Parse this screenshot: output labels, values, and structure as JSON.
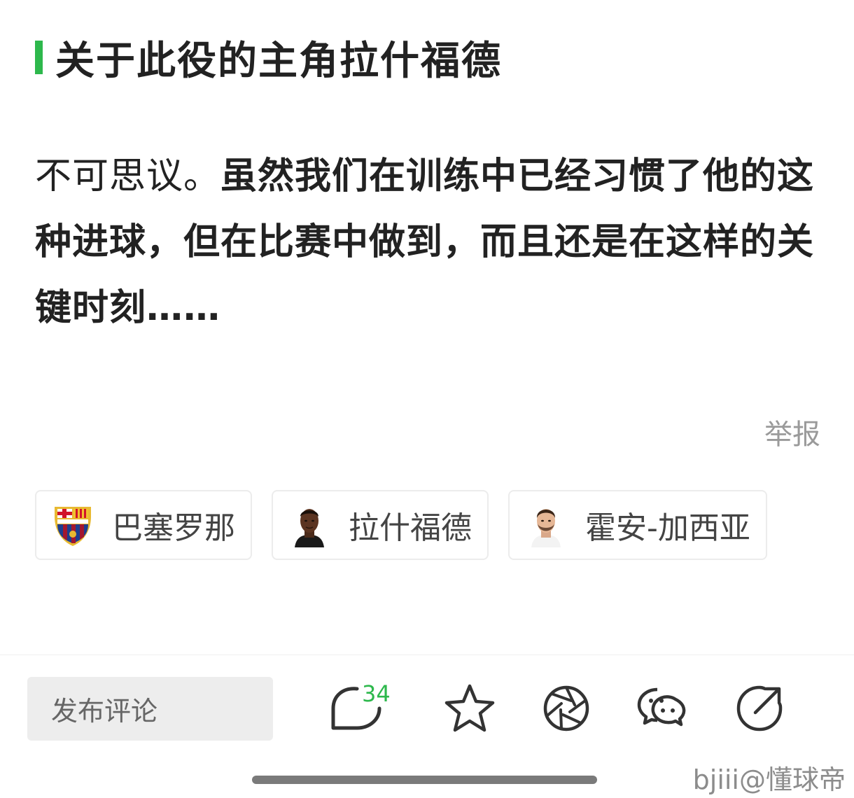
{
  "article": {
    "section_title": "关于此役的主角拉什福德",
    "body_normal": "不可思议。",
    "body_bold": "虽然我们在训练中已经习惯了他的这种进球，但在比赛中做到，而且还是在这样的关键时刻……",
    "report_label": "举报",
    "accent_color": "#2db84c"
  },
  "tags": [
    {
      "label": "巴塞罗那",
      "icon": "fc-barcelona-crest-icon"
    },
    {
      "label": "拉什福德",
      "icon": "player-avatar-icon"
    },
    {
      "label": "霍安-加西亚",
      "icon": "player-avatar-icon"
    }
  ],
  "toolbar": {
    "comment_placeholder": "发布评论",
    "comment_count": "34",
    "buttons": [
      "comment-icon",
      "star-icon",
      "moments-shutter-icon",
      "wechat-icon",
      "share-icon"
    ]
  },
  "watermark": "bjiii@懂球帝"
}
